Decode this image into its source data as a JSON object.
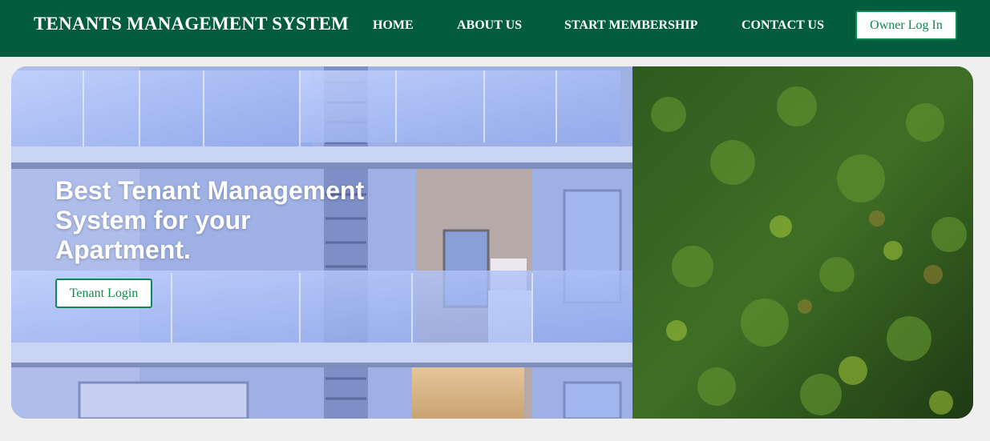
{
  "navbar": {
    "brand": "TENANTS MANAGEMENT SYSTEM",
    "links": [
      {
        "label": "HOME"
      },
      {
        "label": "ABOUT US"
      },
      {
        "label": "START MEMBERSHIP"
      },
      {
        "label": "CONTACT US"
      }
    ],
    "owner_login_label": "Owner Log In"
  },
  "hero": {
    "heading": "Best Tenant Management System for your Apartment.",
    "tenant_login_label": "Tenant Login",
    "image": "apartment-building-with-green-wall"
  },
  "colors": {
    "navbar_bg": "#035c3d",
    "accent": "#0d8a4f",
    "page_bg": "#efefef"
  }
}
